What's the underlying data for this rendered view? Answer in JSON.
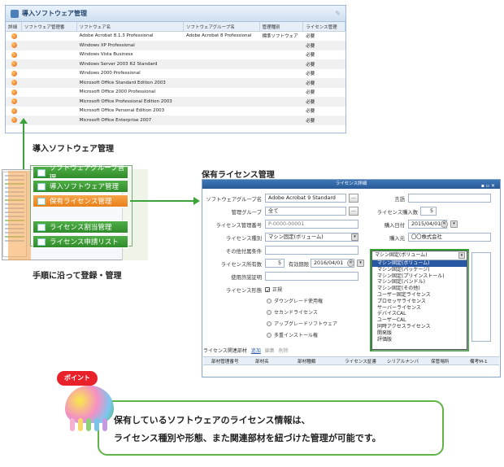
{
  "top_window": {
    "title": "導入ソフトウェア管理",
    "headers": [
      "詳細",
      "ソフトウェア管理番",
      "ソフトウェア名",
      "ソフトウェアグループ名",
      "管理種別",
      "ライセンス管理"
    ],
    "rows": [
      {
        "name": "Adobe Acrobat 8.1.3 Professional",
        "group": "Adobe Acrobat 8 Professional",
        "type": "標準ソフトウェア",
        "license": "必要"
      },
      {
        "name": "Windows XP Professional",
        "group": "",
        "type": "",
        "license": "必要"
      },
      {
        "name": "Windows Vista Business",
        "group": "",
        "type": "",
        "license": "必要"
      },
      {
        "name": "Windows Server 2003 R2 Standard",
        "group": "",
        "type": "",
        "license": "必要"
      },
      {
        "name": "Windows 2000 Professional",
        "group": "",
        "type": "",
        "license": "必要"
      },
      {
        "name": "Microsoft Office Standard Edition 2003",
        "group": "",
        "type": "",
        "license": "必要"
      },
      {
        "name": "Microsoft Office 2000 Professional",
        "group": "",
        "type": "",
        "license": "必要"
      },
      {
        "name": "Microsoft Office Professional Edition 2003",
        "group": "",
        "type": "",
        "license": "必要"
      },
      {
        "name": "Microsoft Office Personal Edition 2003",
        "group": "",
        "type": "",
        "license": "必要"
      },
      {
        "name": "Microsoft Office Enterprise 2007",
        "group": "",
        "type": "",
        "license": "必要"
      }
    ]
  },
  "labels": {
    "installed_software": "導入ソフトウェア管理",
    "owned_license": "保有ライセンス管理",
    "process_note": "手順に沿って登録・管理"
  },
  "menu": [
    "ソフトウェアグループ管理",
    "導入ソフトウェア管理",
    "保有ライセンス管理",
    "ライセンス割当管理",
    "ライセンス申請リスト"
  ],
  "license_window": {
    "title": "ライセンス詳細",
    "fields": {
      "software_group_label": "ソフトウェアグループ名",
      "software_group_value": "Adobe Acrobat 9 Standard",
      "group_label": "管理グループ",
      "group_value": "全て",
      "mgmt_no_label": "ライセンス管理番号",
      "mgmt_no_value": "P-0000-00001",
      "kind_label": "ライセンス種別",
      "kind_value": "マシン固定(ボリューム)",
      "contract_label": "その他付属条件",
      "count_label": "ライセンス所有数",
      "count_value": "5",
      "expire_label": "有効期限",
      "expire_value": "2016/04/01",
      "cert_label": "使用許諾証明",
      "form_label": "ライセンス形態",
      "lang_label": "言語",
      "purchase_count_label": "ライセンス購入数",
      "purchase_count_value": "5",
      "purchase_date_label": "購入日付",
      "purchase_date_value": "2015/04/01",
      "vendor_label": "購入元",
      "vendor_value": "〇〇株式会社"
    },
    "checkboxes": [
      "正規",
      "ダウングレード使用権",
      "セカンドライセンス",
      "アップグレードソフトウェア",
      "多重インストール権"
    ],
    "dropdown": {
      "selected": "マシン固定(ボリューム)",
      "options": [
        "マシン固定(ボリューム)",
        "マシン固定(パッケージ)",
        "マシン固定(プリインストール)",
        "マシン固定(バンドル)",
        "マシン固定(その他)",
        "ユーザー固定ライセンス",
        "プロセッサライセンス",
        "サーバーライセンス",
        "デバイスCAL",
        "ユーザーCAL",
        "同時アクセスライセンス",
        "開発版",
        "評価版"
      ]
    },
    "sub_bar": {
      "title": "ライセンス関連部材",
      "add": "追加",
      "edit": "編集",
      "delete": "削除"
    },
    "sub_headers": [
      "部材管理番号",
      "部材名",
      "部材種類",
      "ライセンス証書",
      "シリアルナンバ",
      "保管場所",
      "備考M-1"
    ]
  },
  "point": {
    "badge": "ポイント",
    "line1": "保有しているソフトウェアのライセンス情報は、",
    "line2": "ライセンス種別や形態、また関連部材を紐づけた管理が可能です。"
  }
}
